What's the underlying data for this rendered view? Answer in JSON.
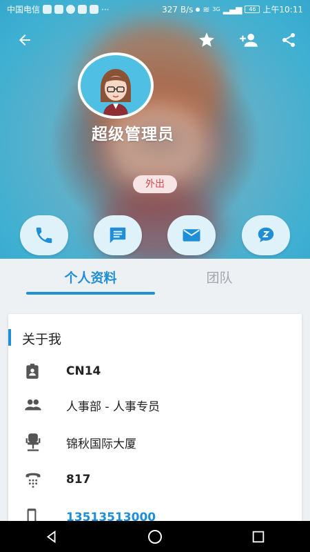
{
  "status_bar": {
    "carrier": "中国电信",
    "speed": "327 B/s",
    "network": "3G",
    "battery": "46",
    "time": "上午10:11"
  },
  "profile": {
    "name": "超级管理员",
    "status": "外出"
  },
  "tabs": {
    "profile": "个人资料",
    "team": "团队"
  },
  "about": {
    "title": "关于我",
    "employee_id": "CN14",
    "department": "人事部 - 人事专员",
    "location": "锦秋国际大厦",
    "extension": "817",
    "mobile": "13513513000"
  },
  "colors": {
    "accent": "#1f8ed6",
    "status_text": "#d2464f"
  },
  "icons": {
    "back": "arrow-left-icon",
    "favorite": "star-icon",
    "add_contact": "add-person-icon",
    "share": "share-icon",
    "call": "phone-icon",
    "message": "chat-icon",
    "email": "mail-icon",
    "chat_app": "z-bubble-icon"
  }
}
